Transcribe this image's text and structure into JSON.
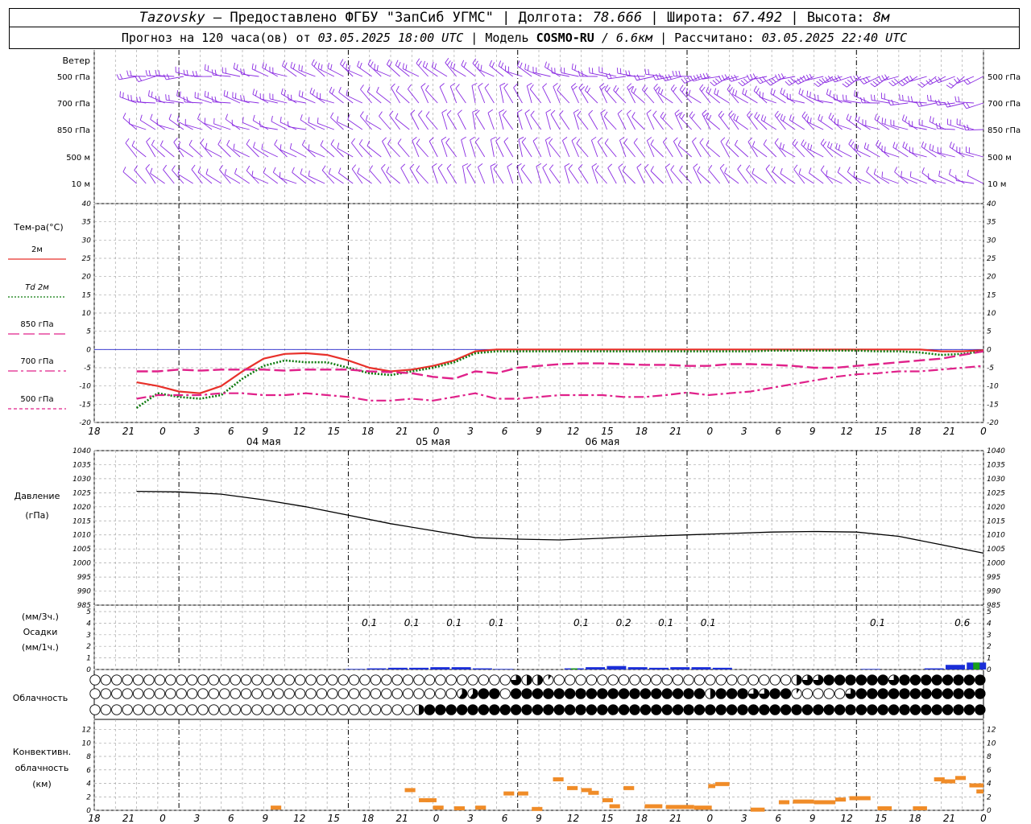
{
  "header": {
    "station": "Tazovsky",
    "dash": " – ",
    "provider": "Предоставлено ФГБУ \"ЗапСиб УГМС\"",
    "sep": " | ",
    "lon_label": "Долгота: ",
    "lon_value": "78.666",
    "lat_label": "Широта: ",
    "lat_value": "67.492",
    "alt_label": "Высота: ",
    "alt_value": "8м",
    "forecast_prefix": "Прогноз на 120 часа(ов)  от ",
    "forecast_from": "03.05.2025 18:00 UTC",
    "model_prefix": " | Модель ",
    "model_name": "COSMO-RU",
    "model_res": " / 6.6км",
    "calc_prefix": " | Рассчитано: ",
    "calc_time": "03.05.2025 22:40 UTC"
  },
  "colors": {
    "wind": "#8a2be2",
    "t2m": "#e8302a",
    "td2m": "#0c7a0c",
    "t850": "#e0218a",
    "t700": "#e0218a",
    "t500": "#e0218a",
    "zero_line": "#2222cc",
    "pressure": "#000000",
    "precip_3h": "#1a2ed8",
    "precip_1h": "#19a019",
    "convective": "#f08c28",
    "grid": "#a8a8a8"
  },
  "chart_data": [
    {
      "type": "wind_barbs",
      "panel_label": "Ветер",
      "levels": [
        "500 гПа",
        "700 гПа",
        "850 гПа",
        "500 м",
        "10  м"
      ],
      "x_hours": [
        0,
        120
      ],
      "description_trend": {
        "500 гПа": {
          "dir_deg": [
            260,
            300,
            310,
            250,
            240
          ],
          "speed_ms": [
            12,
            10,
            8,
            14,
            12
          ],
          "t_hours": [
            0,
            24,
            48,
            84,
            120
          ]
        },
        "700 гПа": {
          "dir_deg": [
            280,
            290,
            340,
            310,
            260
          ],
          "speed_ms": [
            8,
            8,
            6,
            10,
            12
          ],
          "t_hours": [
            0,
            24,
            48,
            84,
            120
          ]
        },
        "850 гПа": {
          "dir_deg": [
            300,
            290,
            340,
            320,
            280
          ],
          "speed_ms": [
            6,
            7,
            6,
            8,
            10
          ],
          "t_hours": [
            0,
            24,
            48,
            84,
            120
          ]
        },
        "500 м": {
          "dir_deg": [
            320,
            300,
            340,
            320,
            290
          ],
          "speed_ms": [
            6,
            6,
            5,
            7,
            9
          ],
          "t_hours": [
            0,
            24,
            48,
            84,
            120
          ]
        },
        "10  м": {
          "dir_deg": [
            320,
            300,
            340,
            320,
            290
          ],
          "speed_ms": [
            4,
            4,
            4,
            5,
            6
          ],
          "t_hours": [
            0,
            24,
            48,
            84,
            120
          ]
        }
      }
    },
    {
      "type": "line",
      "panel_label": "Тем-ра(°С)",
      "ylim": [
        -20,
        40
      ],
      "yticks": [
        -20,
        -15,
        -10,
        -5,
        0,
        5,
        10,
        15,
        20,
        25,
        30,
        35,
        40
      ],
      "x_hours": [
        0,
        3,
        6,
        9,
        12,
        15,
        18,
        21,
        24,
        27,
        30,
        33,
        36,
        39,
        42,
        45,
        48,
        51,
        54,
        57,
        60,
        63,
        66,
        69,
        72,
        75,
        78,
        81,
        84,
        87,
        90,
        93,
        96,
        99,
        102,
        105,
        108,
        111,
        114,
        117,
        120
      ],
      "series": [
        {
          "name": "2м",
          "style": "solid",
          "values": [
            -9,
            -10,
            -11.5,
            -12,
            -10,
            -6,
            -2.5,
            -1.2,
            -1,
            -1.5,
            -3,
            -5,
            -6,
            -5.5,
            -4.5,
            -3,
            -0.5,
            0,
            0,
            0,
            0,
            0,
            0,
            0,
            0,
            0,
            0,
            0,
            0,
            0,
            0,
            0,
            0,
            0,
            0,
            0,
            0,
            0,
            -0.5,
            -0.5,
            -0.2
          ]
        },
        {
          "name": "Td  2м",
          "style": "dotted",
          "values": [
            -16,
            -12,
            -13,
            -13.5,
            -12.5,
            -8,
            -4.5,
            -3,
            -3.5,
            -3.5,
            -5,
            -6.5,
            -7,
            -6,
            -5,
            -3.5,
            -1,
            -0.5,
            -0.5,
            -0.5,
            -0.5,
            -0.5,
            -0.5,
            -0.5,
            -0.5,
            -0.5,
            -0.5,
            -0.5,
            -0.5,
            -0.5,
            -0.3,
            -0.3,
            -0.3,
            -0.3,
            -0.3,
            -0.5,
            -0.5,
            -0.8,
            -1.5,
            -1.2,
            -0.5
          ]
        },
        {
          "name": "850 гПа",
          "style": "longdash",
          "values": [
            -6,
            -6,
            -5.5,
            -5.8,
            -5.5,
            -5.5,
            -5.5,
            -5.8,
            -5.5,
            -5.5,
            -5.5,
            -6,
            -6.2,
            -6.5,
            -7.5,
            -8,
            -6,
            -6.5,
            -5,
            -4.5,
            -4,
            -3.8,
            -3.8,
            -4,
            -4.2,
            -4.2,
            -4.5,
            -4.5,
            -4,
            -4,
            -4.2,
            -4.5,
            -5,
            -5,
            -4.5,
            -4,
            -3.5,
            -3,
            -2.5,
            -1.5,
            -0.5
          ]
        },
        {
          "name": "700 гПа",
          "style": "dashdot",
          "values": [
            -13.5,
            -12.5,
            -12.5,
            -12.5,
            -12,
            -12,
            -12.5,
            -12.5,
            -12,
            -12.5,
            -13,
            -14,
            -14,
            -13.5,
            -14,
            -13,
            -12,
            -13.5,
            -13.5,
            -13,
            -12.5,
            -12.5,
            -12.5,
            -13,
            -13,
            -12.5,
            -11.8,
            -12.5,
            -12,
            -11.5,
            -10.5,
            -9.5,
            -8.5,
            -7.5,
            -6.8,
            -6.5,
            -6,
            -6,
            -5.5,
            -5,
            -4.5
          ]
        }
      ],
      "legend_only": [
        {
          "name": "500 гПа",
          "style": "shortdash"
        }
      ],
      "zero_line": true
    },
    {
      "type": "line",
      "panel_label": [
        "Давление",
        "(гПа)"
      ],
      "ylim": [
        985,
        1040
      ],
      "yticks": [
        985,
        990,
        995,
        1000,
        1005,
        1010,
        1015,
        1020,
        1025,
        1030,
        1035,
        1040
      ],
      "x_hours": [
        0,
        6,
        12,
        18,
        24,
        30,
        36,
        42,
        48,
        54,
        60,
        66,
        72,
        78,
        84,
        90,
        96,
        102,
        108,
        114,
        120
      ],
      "series": [
        {
          "name": "pressure",
          "values": [
            1025.5,
            1025.3,
            1024.5,
            1022.5,
            1020,
            1017,
            1014,
            1011.5,
            1009,
            1008.5,
            1008.2,
            1008.8,
            1009.5,
            1010,
            1010.5,
            1011,
            1011.2,
            1011,
            1009.5,
            1006.5,
            1003.5
          ]
        }
      ]
    },
    {
      "type": "bar",
      "panel_label": [
        "(мм/3ч.)",
        "Осадки",
        "(мм/1ч.)"
      ],
      "ylim": [
        0,
        5
      ],
      "yticks": [
        0,
        1,
        2,
        3,
        4,
        5
      ],
      "annotations": [
        {
          "hour": 33,
          "text": "0.1"
        },
        {
          "hour": 39,
          "text": "0.1"
        },
        {
          "hour": 45,
          "text": "0.1"
        },
        {
          "hour": 51,
          "text": "0.1"
        },
        {
          "hour": 63,
          "text": "0.1"
        },
        {
          "hour": 69,
          "text": "0.2"
        },
        {
          "hour": 75,
          "text": "0.1"
        },
        {
          "hour": 81,
          "text": "0.1"
        },
        {
          "hour": 105,
          "text": "0.1"
        },
        {
          "hour": 117,
          "text": "0.6"
        }
      ],
      "series": [
        {
          "name": "3h",
          "bars": [
            [
              31,
              0.05
            ],
            [
              34,
              0.1
            ],
            [
              37,
              0.15
            ],
            [
              40,
              0.15
            ],
            [
              43,
              0.2
            ],
            [
              46,
              0.2
            ],
            [
              49,
              0.1
            ],
            [
              52,
              0.05
            ],
            [
              62,
              0.1
            ],
            [
              65,
              0.2
            ],
            [
              68,
              0.3
            ],
            [
              71,
              0.2
            ],
            [
              74,
              0.15
            ],
            [
              77,
              0.2
            ],
            [
              80,
              0.2
            ],
            [
              83,
              0.15
            ],
            [
              104,
              0.05
            ],
            [
              113,
              0.1
            ],
            [
              116,
              0.4
            ],
            [
              119,
              0.6
            ]
          ]
        },
        {
          "name": "1h",
          "bars": [
            [
              62,
              0.1
            ],
            [
              119,
              0.6
            ]
          ]
        }
      ]
    },
    {
      "type": "cloud_cover",
      "panel_label": "Облачность",
      "layers": [
        "upper",
        "middle",
        "lower"
      ],
      "x_step_hours": 1.333,
      "coverage_runs": {
        "upper": [
          [
            0,
            0
          ],
          [
            53,
            0.75
          ],
          [
            55,
            0.5
          ],
          [
            57,
            0.1
          ],
          [
            59,
            0
          ],
          [
            93,
            0.5
          ],
          [
            95,
            0.75
          ],
          [
            97,
            1
          ],
          [
            100,
            1
          ],
          [
            106,
            0.75
          ],
          [
            108,
            1
          ],
          [
            120,
            1
          ]
        ],
        "middle": [
          [
            0,
            0
          ],
          [
            46,
            0.6
          ],
          [
            48,
            0
          ],
          [
            49,
            1
          ],
          [
            51,
            0
          ],
          [
            53,
            1
          ],
          [
            80,
            0.5
          ],
          [
            82,
            1
          ],
          [
            87,
            0.75
          ],
          [
            89,
            1
          ],
          [
            92,
            0.1
          ],
          [
            94,
            0
          ],
          [
            100,
            0.75
          ],
          [
            102,
            1
          ],
          [
            120,
            1
          ]
        ],
        "lower": [
          [
            0,
            0
          ],
          [
            39,
            0.5
          ],
          [
            40,
            1
          ],
          [
            120,
            1
          ]
        ]
      }
    },
    {
      "type": "bar",
      "panel_label": [
        "Конвективн.",
        "облачность",
        "(км)"
      ],
      "ylim": [
        0,
        13
      ],
      "yticks": [
        0,
        2,
        4,
        6,
        8,
        10,
        12
      ],
      "segments_km": [
        [
          19,
          20.5,
          0.4
        ],
        [
          38,
          39.5,
          3
        ],
        [
          40,
          41.5,
          1.5
        ],
        [
          41,
          42.5,
          1.5
        ],
        [
          42,
          43.5,
          0.4
        ],
        [
          45,
          46.5,
          0.3
        ],
        [
          48,
          49.5,
          0.4
        ],
        [
          52,
          53.5,
          2.5
        ],
        [
          54,
          55.5,
          2.5
        ],
        [
          56,
          57.5,
          0.2
        ],
        [
          59,
          60.5,
          4.6
        ],
        [
          61,
          62.5,
          3.3
        ],
        [
          63,
          64.5,
          3
        ],
        [
          64,
          65.5,
          2.6
        ],
        [
          66,
          67.5,
          1.5
        ],
        [
          67,
          68.5,
          0.6
        ],
        [
          69,
          70.5,
          3.3
        ],
        [
          72,
          74.5,
          0.6
        ],
        [
          75,
          79,
          0.5
        ],
        [
          79,
          81.5,
          0.4
        ],
        [
          81,
          82,
          3.6
        ],
        [
          82,
          84,
          3.9
        ],
        [
          87,
          89,
          0.1
        ],
        [
          91,
          92.5,
          1.2
        ],
        [
          93,
          96,
          1.3
        ],
        [
          96,
          99,
          1.2
        ],
        [
          99,
          100.5,
          1.6
        ],
        [
          101,
          104,
          1.8
        ],
        [
          105,
          107,
          0.3
        ],
        [
          110,
          112,
          0.3
        ],
        [
          113,
          114.5,
          4.6
        ],
        [
          114,
          116,
          4.3
        ],
        [
          116,
          117.5,
          4.8
        ],
        [
          118,
          120,
          3.7
        ],
        [
          119,
          120,
          2.8
        ]
      ]
    },
    {
      "type": "axis",
      "tick_labels": [
        "18",
        "21",
        "0",
        "3",
        "6",
        "9",
        "12",
        "15",
        "18",
        "21",
        "0",
        "3",
        "6",
        "9",
        "12",
        "15",
        "18",
        "21",
        "0",
        "3",
        "6",
        "9",
        "12",
        "15",
        "18",
        "21",
        "0"
      ],
      "day_labels": [
        "04 мая",
        "05 мая",
        "06 мая"
      ]
    }
  ]
}
